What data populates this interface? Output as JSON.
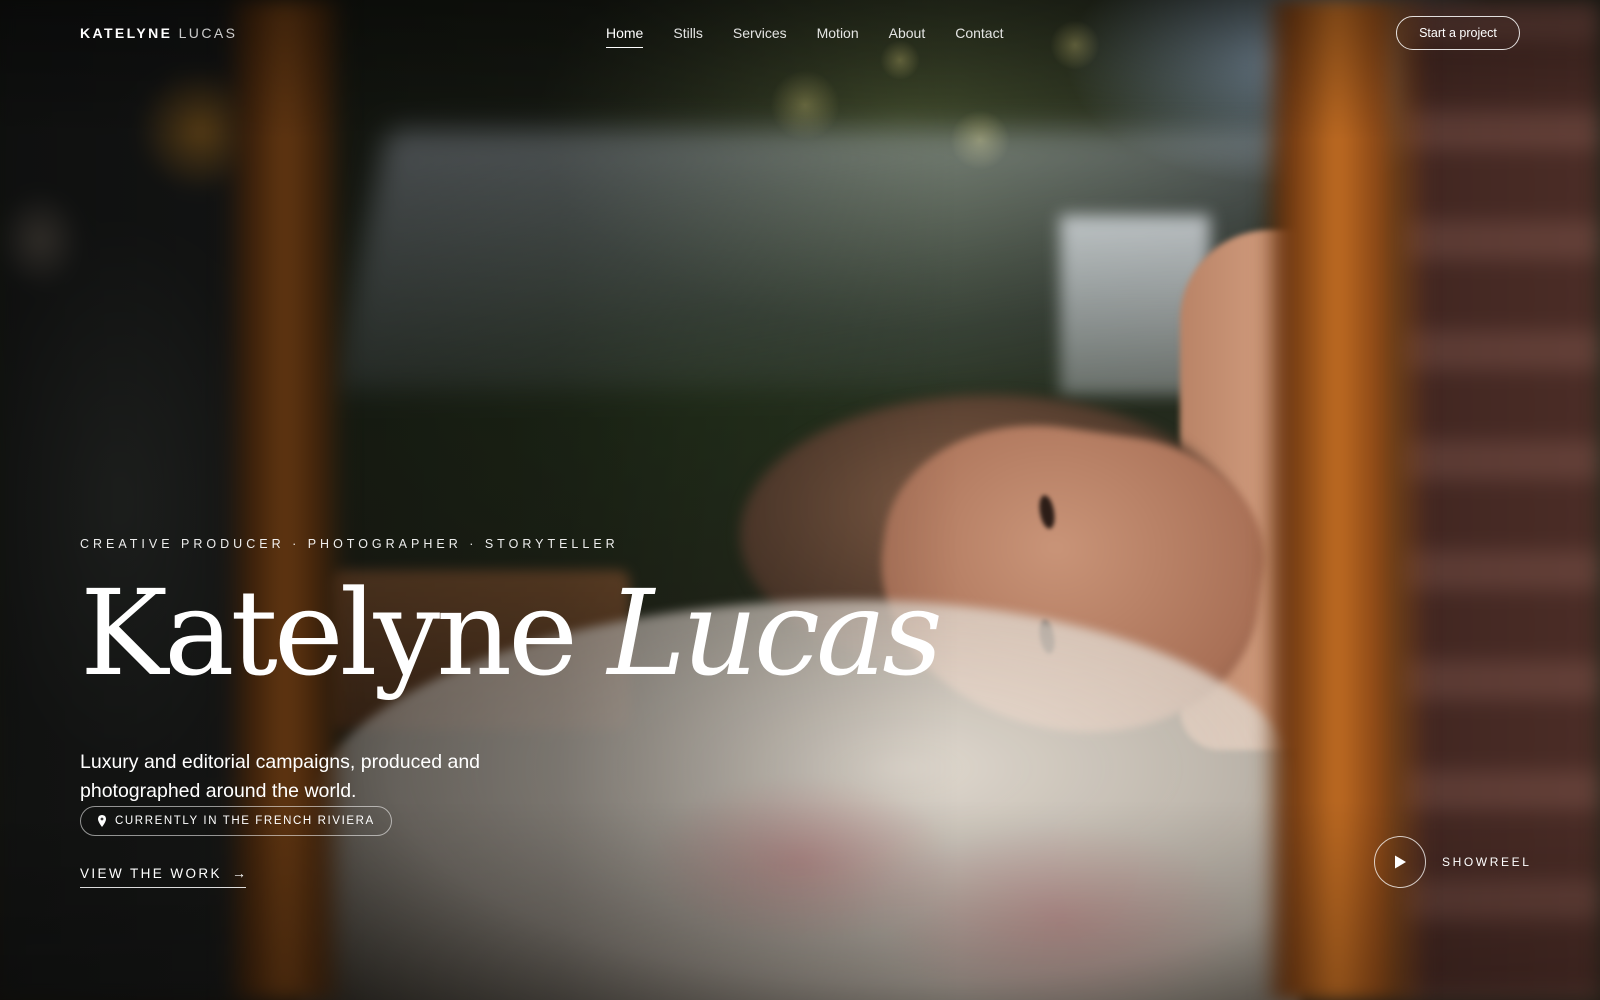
{
  "brand": {
    "first": "KATELYNE",
    "last": "LUCAS"
  },
  "nav": {
    "items": [
      {
        "label": "Home",
        "active": true
      },
      {
        "label": "Stills"
      },
      {
        "label": "Services"
      },
      {
        "label": "Motion"
      },
      {
        "label": "About"
      },
      {
        "label": "Contact"
      }
    ],
    "cta": "Start a project"
  },
  "hero": {
    "eyebrow": "CREATIVE PRODUCER · PHOTOGRAPHER · STORYTELLER",
    "title_first": "Katelyne",
    "title_last": "Lucas",
    "subtitle": "Luxury and editorial campaigns, produced and photographed around the world.",
    "location": "CURRENTLY IN THE FRENCH RIVIERA",
    "view_work": "VIEW THE WORK",
    "showreel": "SHOWREEL"
  },
  "icons": {
    "location": "map-pin-icon",
    "arrow": "arrow-right-icon",
    "play": "play-icon"
  }
}
